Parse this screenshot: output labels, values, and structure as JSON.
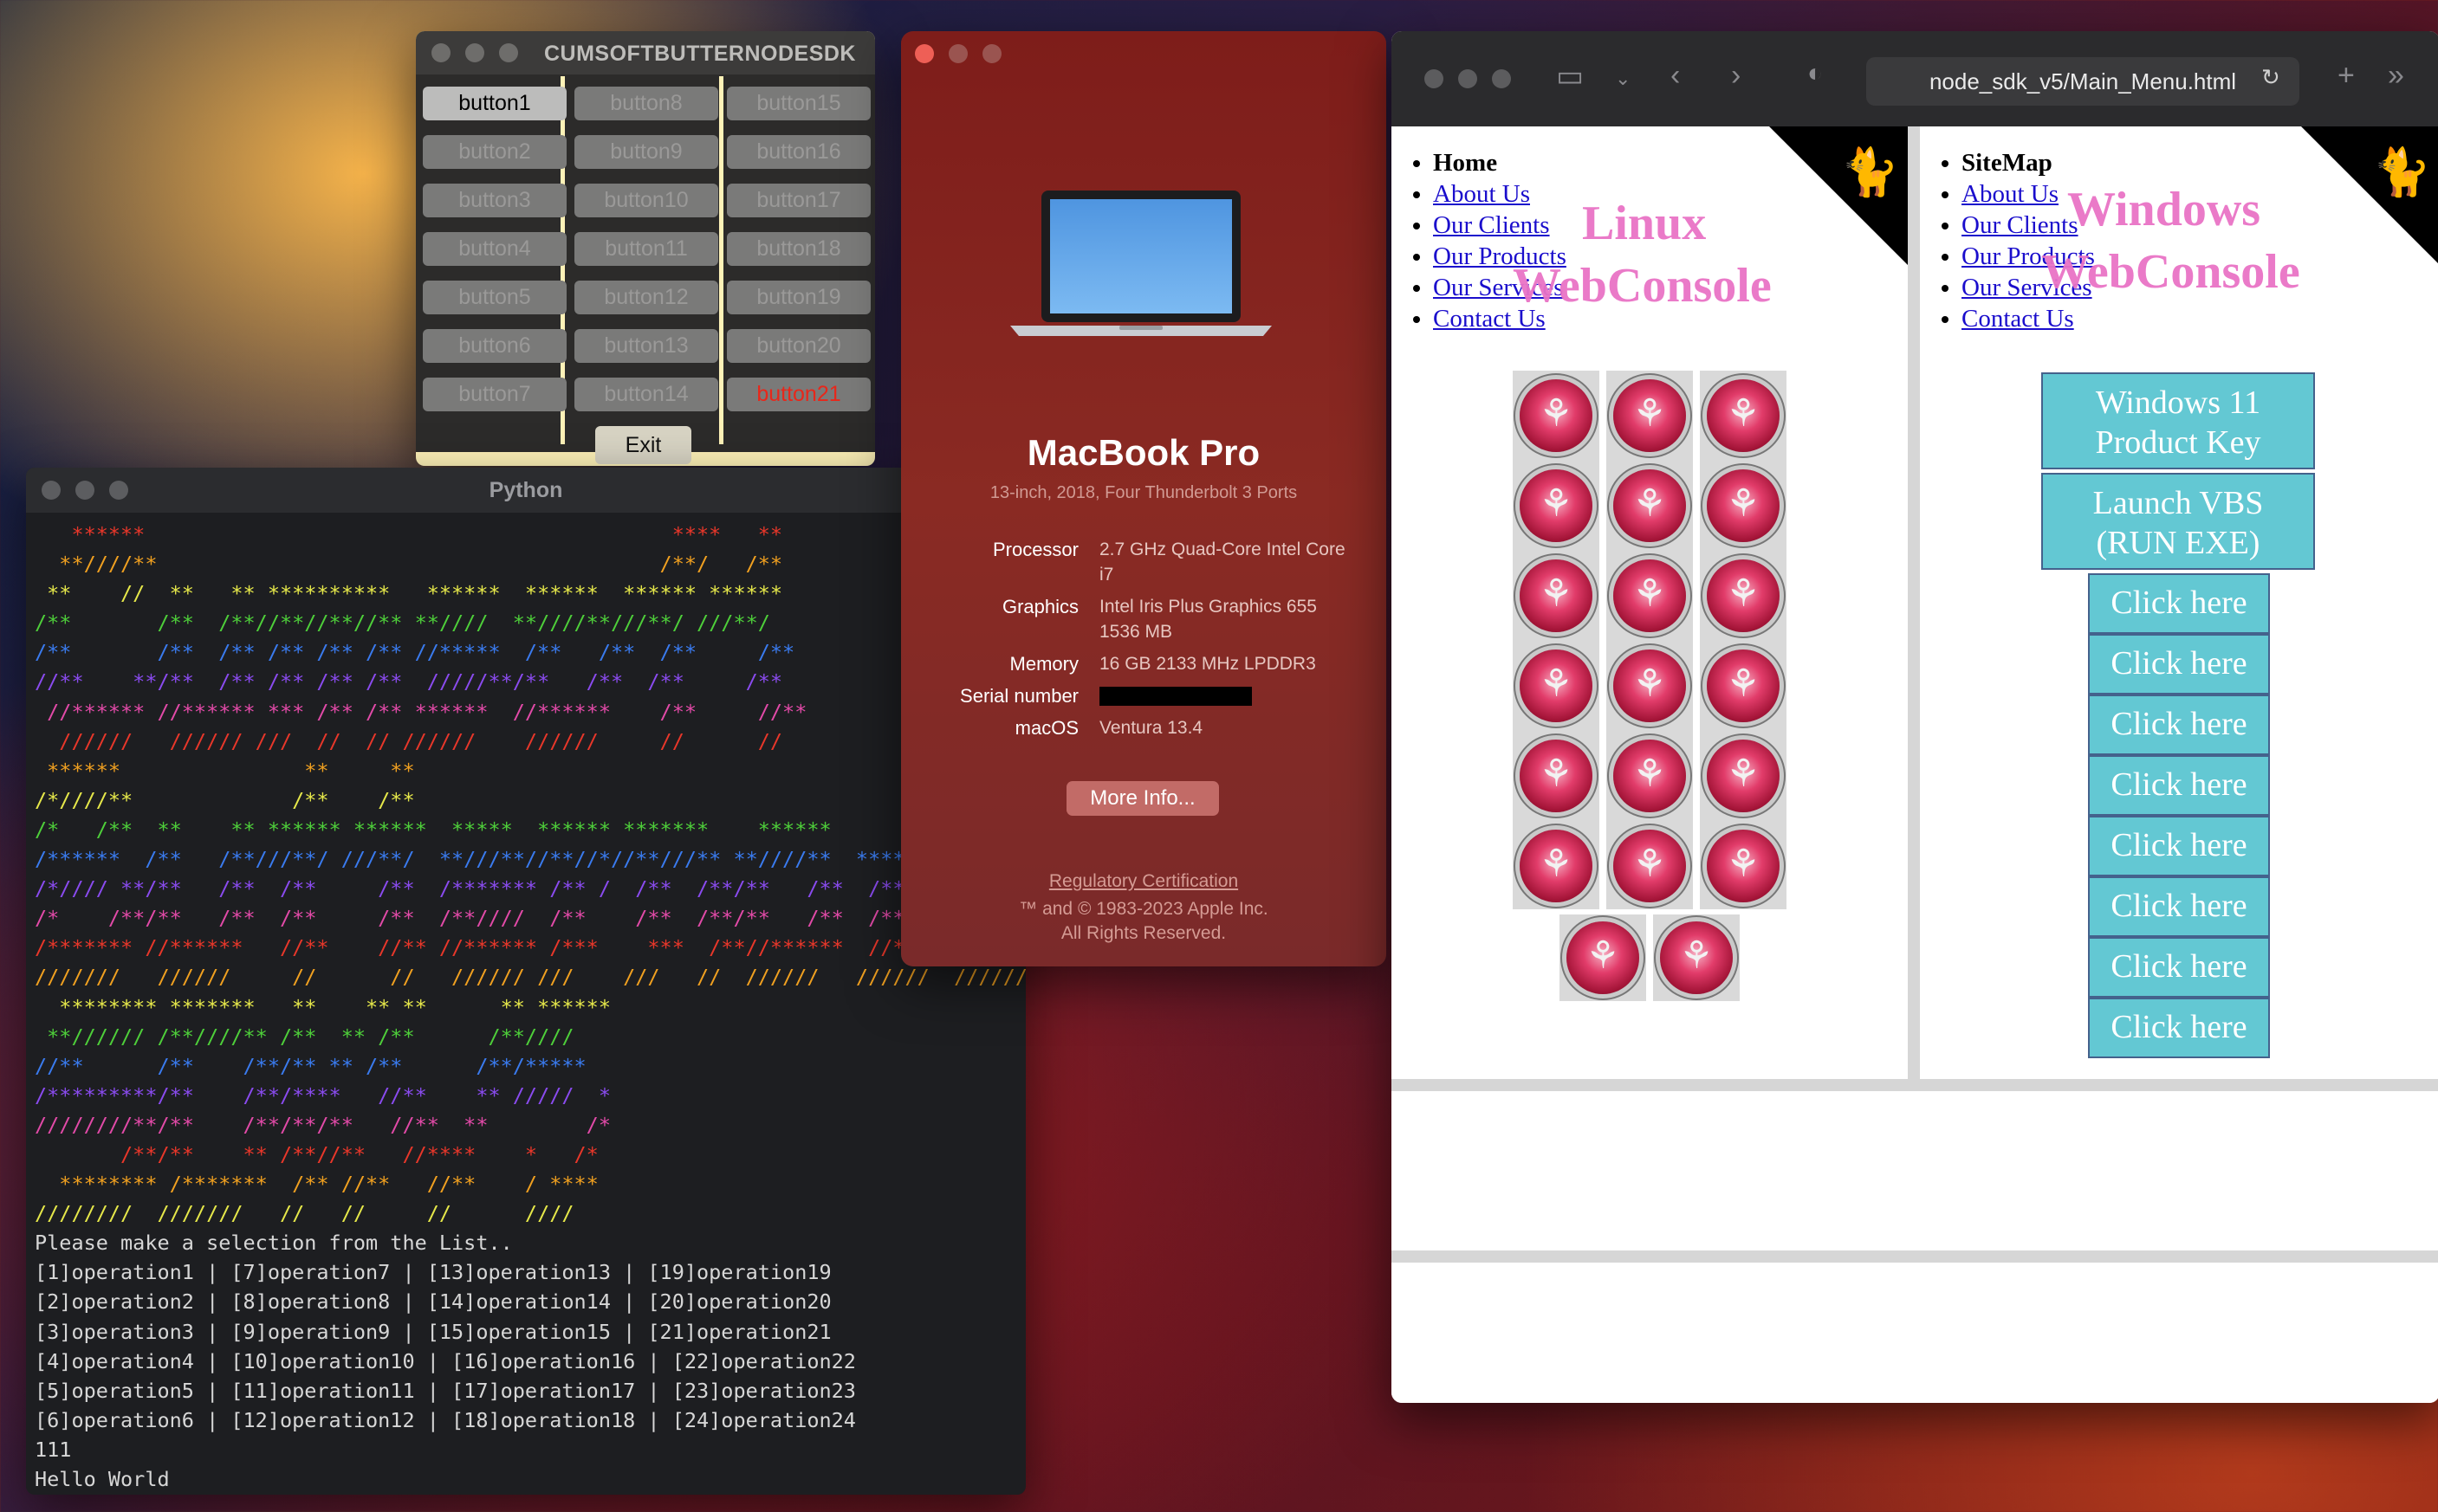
{
  "tk_window": {
    "title": "CUMSOFTBUTTERNODESDK",
    "col1": [
      "button1",
      "button2",
      "button3",
      "button4",
      "button5",
      "button6",
      "button7"
    ],
    "col2": [
      "button8",
      "button9",
      "button10",
      "button11",
      "button12",
      "button13",
      "button14"
    ],
    "col3": [
      "button15",
      "button16",
      "button17",
      "button18",
      "button19",
      "button20",
      "button21"
    ],
    "exit": "Exit"
  },
  "python_window": {
    "title": "Python",
    "banner_colors": [
      "#e8372a",
      "#f0a020",
      "#e6e84a",
      "#4ecf3a",
      "#3a7bef",
      "#8a4bef",
      "#e24aa8"
    ],
    "banner": [
      {
        "c": "#e8372a",
        "t": "   ******                                           ****   **"
      },
      {
        "c": "#f0a020",
        "t": "  **////**                                         /**/   /**"
      },
      {
        "c": "#e6e84a",
        "t": " **    //  **   ** **********   ******  ******  ****** ******"
      },
      {
        "c": "#4ecf3a",
        "t": "/**       /**  /**//**//**//** **////  **////**///**/ ///**/"
      },
      {
        "c": "#3a7bef",
        "t": "/**       /**  /** /** /** /** //*****  /**   /**  /**     /**"
      },
      {
        "c": "#8a4bef",
        "t": "//**    **/**  /** /** /** /**  /////**/**   /**  /**     /**"
      },
      {
        "c": "#e24aa8",
        "t": " //****** //****** *** /** /** ******  //******    /**     //**"
      },
      {
        "c": "#e8372a",
        "t": "  //////   ////// ///  //  // //////    //////     //      //"
      },
      {
        "c": "#f0a020",
        "t": " ******               **     **                                             *"
      },
      {
        "c": "#e6e84a",
        "t": "/*////**             /**    /**                                            /*"
      },
      {
        "c": "#4ecf3a",
        "t": "/*   /**  **    ** ****** ******  *****  ****** *******    ******         /*"
      },
      {
        "c": "#3a7bef",
        "t": "/******  /**   /**///**/ ///**/  **///**//**//*//**///** **////**  ******"
      },
      {
        "c": "#8a4bef",
        "t": "/*//// **/**   /**  /**     /**  /******* /** /  /**  /**/**   /**  /** **///*"
      },
      {
        "c": "#e24aa8",
        "t": "/*    /**/**   /**  /**     /**  /**////  /**    /**  /**/**   /**  /**//// *"
      },
      {
        "c": "#e8372a",
        "t": "/******* //******   //**    //** //****** /***    ***  /**//******  //****** "
      },
      {
        "c": "#f0a020",
        "t": "///////   //////     //      //   ////// ///    ///   //  //////   //////  //////"
      },
      {
        "c": "#e6e84a",
        "t": "  ******** *******   **    ** **      ** ******"
      },
      {
        "c": "#4ecf3a",
        "t": " **////// /**////** /**  ** /**      /**////"
      },
      {
        "c": "#3a7bef",
        "t": "//**      /**    /**/** ** /**      /**/*****"
      },
      {
        "c": "#8a4bef",
        "t": "/*********/**    /**/****   //**    ** /////  *"
      },
      {
        "c": "#e24aa8",
        "t": "////////**/**    /**/**/**   //**  **        /*"
      },
      {
        "c": "#e8372a",
        "t": "       /**/**    ** /**//**   //****    *   /*"
      },
      {
        "c": "#f0a020",
        "t": "  ******** /*******  /** //**   //**    / ****"
      },
      {
        "c": "#e6e84a",
        "t": "////////  ///////   //   //     //      ////"
      }
    ],
    "output": [
      "Please make a selection from the List..",
      "[1]operation1 | [7]operation7 | [13]operation13 | [19]operation19",
      "[2]operation2 | [8]operation8 | [14]operation14 | [20]operation20",
      "[3]operation3 | [9]operation9 | [15]operation15 | [21]operation21",
      "[4]operation4 | [10]operation10 | [16]operation16 | [22]operation22",
      "[5]operation5 | [11]operation11 | [17]operation17 | [23]operation23",
      "[6]operation6 | [12]operation12 | [18]operation18 | [24]operation24",
      "111",
      "Hello World"
    ]
  },
  "about_mac": {
    "name": "MacBook Pro",
    "subtitle": "13-inch, 2018, Four Thunderbolt 3 Ports",
    "specs": {
      "processor_k": "Processor",
      "processor_v": "2.7 GHz Quad-Core Intel Core i7",
      "graphics_k": "Graphics",
      "graphics_v": "Intel Iris Plus Graphics 655 1536 MB",
      "memory_k": "Memory",
      "memory_v": "16 GB 2133 MHz LPDDR3",
      "serial_k": "Serial number",
      "macos_k": "macOS",
      "macos_v": "Ventura 13.4"
    },
    "more_info": "More Info...",
    "regulatory": "Regulatory Certification",
    "copyright1": "™ and © 1983-2023 Apple Inc.",
    "copyright2": "All Rights Reserved."
  },
  "safari": {
    "url": "node_sdk_v5/Main_Menu.html",
    "left_frame": {
      "items": [
        "Home",
        "About Us",
        "Our Clients",
        "Our Products",
        "Our Services",
        "Contact Us"
      ],
      "overlay1": "Linux",
      "overlay2": "WebConsole"
    },
    "right_frame": {
      "items": [
        "SiteMap",
        "About Us",
        "Our Clients",
        "Our Products",
        "Our Services",
        "Contact Us"
      ],
      "overlay1": "Windows",
      "overlay2": "WebConsole",
      "btn_key_1": "Windows 11",
      "btn_key_2": "Product Key",
      "btn_vbs_1": "Launch VBS",
      "btn_vbs_2": "(RUN EXE)",
      "click_here": [
        "Click here",
        "Click here",
        "Click here",
        "Click here",
        "Click here",
        "Click here",
        "Click here",
        "Click here"
      ]
    }
  }
}
